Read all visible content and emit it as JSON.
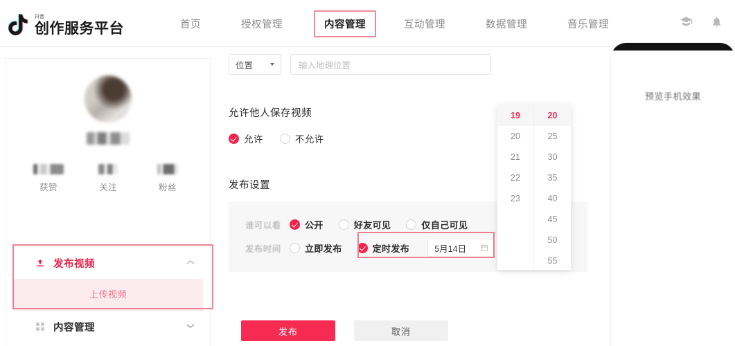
{
  "header": {
    "logo_sub": "抖音",
    "logo_main": "创作服务平台",
    "logo_icon": "douyin-note-icon",
    "nav": [
      {
        "label": "首页",
        "active": false,
        "annotated": false
      },
      {
        "label": "授权管理",
        "active": false,
        "annotated": false
      },
      {
        "label": "内容管理",
        "active": true,
        "annotated": true
      },
      {
        "label": "互动管理",
        "active": false,
        "annotated": false
      },
      {
        "label": "数据管理",
        "active": false,
        "annotated": false
      },
      {
        "label": "音乐管理",
        "active": false,
        "annotated": false
      }
    ],
    "icons": [
      {
        "name": "graduation-cap-icon"
      },
      {
        "name": "bell-icon"
      }
    ]
  },
  "sidebar": {
    "profile": {
      "avatar": "user-avatar",
      "username": "",
      "stats": [
        {
          "value": "",
          "label": "获赞"
        },
        {
          "value": "",
          "label": "关注"
        },
        {
          "value": "",
          "label": "粉丝"
        }
      ]
    },
    "menu": [
      {
        "label": "发布视频",
        "icon": "upload-icon",
        "active": true,
        "expanded": true,
        "chevron": "︿",
        "children": [
          {
            "label": "上传视频",
            "selected": true
          }
        ]
      },
      {
        "label": "内容管理",
        "icon": "grid-icon",
        "active": false,
        "expanded": false,
        "chevron": "﹀",
        "children": []
      }
    ]
  },
  "form": {
    "location": {
      "select_label": "位置",
      "input_placeholder": "输入地理位置"
    },
    "save_section": {
      "title": "允许他人保存视频",
      "options": [
        {
          "label": "允许",
          "selected": true
        },
        {
          "label": "不允许",
          "selected": false
        }
      ]
    },
    "publish_section": {
      "title": "发布设置",
      "visibility": {
        "key": "谁可以看",
        "options": [
          {
            "label": "公开",
            "selected": true
          },
          {
            "label": "好友可见",
            "selected": false
          },
          {
            "label": "仅自己可见",
            "selected": false
          }
        ]
      },
      "timing": {
        "key": "发布时间",
        "options": [
          {
            "label": "立即发布",
            "selected": false
          },
          {
            "label": "定时发布",
            "selected": true
          }
        ],
        "date_value": "5月14日",
        "calendar_icon": "calendar-icon"
      }
    },
    "actions": {
      "publish": "发布",
      "cancel": "取消"
    }
  },
  "timepicker": {
    "hours": [
      {
        "value": "19",
        "selected": true
      },
      {
        "value": "20",
        "selected": false
      },
      {
        "value": "21",
        "selected": false
      },
      {
        "value": "22",
        "selected": false
      },
      {
        "value": "23",
        "selected": false
      }
    ],
    "minutes": [
      {
        "value": "20",
        "selected": true
      },
      {
        "value": "25",
        "selected": false
      },
      {
        "value": "30",
        "selected": false
      },
      {
        "value": "35",
        "selected": false
      },
      {
        "value": "40",
        "selected": false
      },
      {
        "value": "45",
        "selected": false
      },
      {
        "value": "50",
        "selected": false
      },
      {
        "value": "55",
        "selected": false
      }
    ]
  },
  "preview": {
    "label": "预览手机效果"
  },
  "colors": {
    "accent": "#f72b52",
    "accent_soft": "#fdecef",
    "annotation": "#ef8292",
    "panel_bg": "#f7f7f8"
  }
}
